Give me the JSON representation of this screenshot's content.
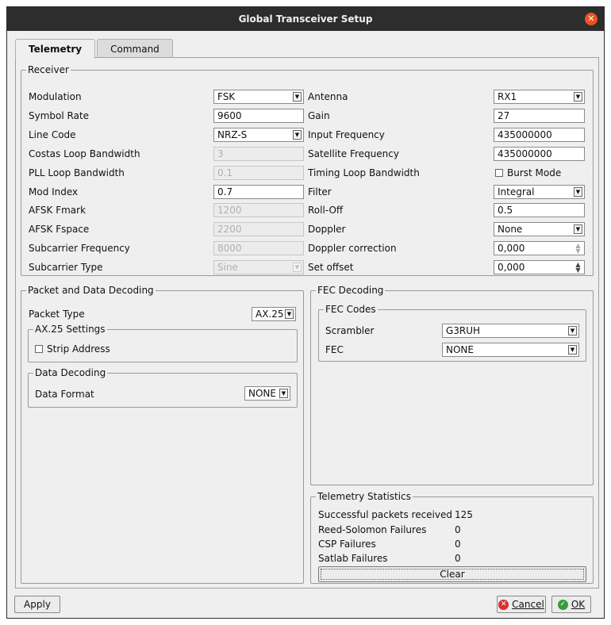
{
  "window": {
    "title": "Global Transceiver Setup"
  },
  "tabs": [
    {
      "label": "Telemetry"
    },
    {
      "label": "Command"
    }
  ],
  "receiver": {
    "title": "Receiver",
    "modulation": {
      "label": "Modulation",
      "value": "FSK"
    },
    "symbol_rate": {
      "label": "Symbol Rate",
      "value": "9600"
    },
    "line_code": {
      "label": "Line Code",
      "value": "NRZ-S"
    },
    "costas_bw": {
      "label": "Costas Loop Bandwidth",
      "value": "3"
    },
    "pll_bw": {
      "label": "PLL Loop Bandwidth",
      "value": "0.1"
    },
    "mod_index": {
      "label": "Mod Index",
      "value": "0.7"
    },
    "afsk_fmark": {
      "label": "AFSK Fmark",
      "value": "1200"
    },
    "afsk_fspace": {
      "label": "AFSK Fspace",
      "value": "2200"
    },
    "subcarrier_freq": {
      "label": "Subcarrier Frequency",
      "value": "8000"
    },
    "subcarrier_type": {
      "label": "Subcarrier Type",
      "value": "Sine"
    },
    "antenna": {
      "label": "Antenna",
      "value": "RX1"
    },
    "gain": {
      "label": "Gain",
      "value": "27"
    },
    "input_freq": {
      "label": "Input Frequency",
      "value": "435000000"
    },
    "satellite_freq": {
      "label": "Satellite Frequency",
      "value": "435000000"
    },
    "timing_bw": {
      "label": "Timing Loop Bandwidth"
    },
    "burst_mode": {
      "label": "Burst Mode"
    },
    "filter": {
      "label": "Filter",
      "value": "Integral"
    },
    "rolloff": {
      "label": "Roll-Off",
      "value": "0.5"
    },
    "doppler": {
      "label": "Doppler",
      "value": "None"
    },
    "doppler_correction": {
      "label": "Doppler correction",
      "value": "0,000"
    },
    "set_offset": {
      "label": "Set offset",
      "value": "0,000"
    }
  },
  "packet": {
    "title": "Packet and Data Decoding",
    "packet_type": {
      "label": "Packet Type",
      "value": "AX.25"
    },
    "ax25_title": "AX.25 Settings",
    "strip_address": {
      "label": "Strip Address"
    },
    "data_decoding_title": "Data Decoding",
    "data_format": {
      "label": "Data Format",
      "value": "NONE"
    }
  },
  "fec": {
    "title": "FEC Decoding",
    "codes_title": "FEC Codes",
    "scrambler": {
      "label": "Scrambler",
      "value": "G3RUH"
    },
    "fec": {
      "label": "FEC",
      "value": "NONE"
    }
  },
  "stats": {
    "title": "Telemetry Statistics",
    "rows": [
      {
        "label": "Successful packets received",
        "value": "125"
      },
      {
        "label": "Reed-Solomon Failures",
        "value": "0"
      },
      {
        "label": "CSP Failures",
        "value": "0"
      },
      {
        "label": "Satlab Failures",
        "value": "0"
      }
    ],
    "clear_label": "Clear"
  },
  "footer": {
    "apply": "Apply",
    "cancel": "Cancel",
    "ok": "OK"
  },
  "colors": {
    "titlebar": "#2d2d2d",
    "close": "#e95420",
    "cancel_icon": "#d9302c",
    "ok_icon": "#3a9a3a"
  }
}
